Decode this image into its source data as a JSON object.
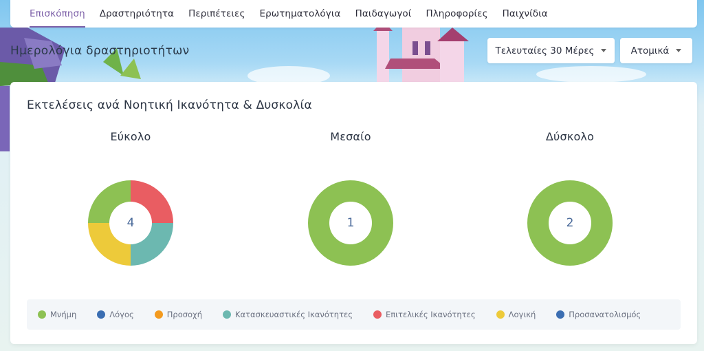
{
  "nav": {
    "items": [
      {
        "label": "Επισκόπηση",
        "active": true
      },
      {
        "label": "Δραστηριότητα"
      },
      {
        "label": "Περιπέτειες"
      },
      {
        "label": "Ερωτηματολόγια"
      },
      {
        "label": "Παιδαγωγοί"
      },
      {
        "label": "Πληροφορίες"
      },
      {
        "label": "Παιχνίδια"
      }
    ]
  },
  "header": {
    "title": "Ημερολόγια δραστηριοτήτων",
    "period_dropdown": "Τελευταίες 30 Μέρες",
    "mode_dropdown": "Ατομικά"
  },
  "card": {
    "title": "Εκτελέσεις ανά Νοητική Ικανότητα & Δυσκολία"
  },
  "colors": {
    "memory": "#8dc153",
    "speech": "#3b6eb2",
    "attention": "#f39a1e",
    "constructive": "#6cb8b0",
    "executive": "#e95d62",
    "logic": "#edca3a",
    "orientation": "#3b6eb2"
  },
  "chart_data": [
    {
      "type": "pie",
      "title": "Εύκολο",
      "center_label": "4",
      "categories": [
        "Επιτελικές Ικανότητες",
        "Κατασκευαστικές Ικανότητες",
        "Λογική",
        "Μνήμη"
      ],
      "values": [
        1,
        1,
        1,
        1
      ],
      "colors": [
        "#e95d62",
        "#6cb8b0",
        "#edca3a",
        "#8dc153"
      ]
    },
    {
      "type": "pie",
      "title": "Μεσαίο",
      "center_label": "1",
      "categories": [
        "Μνήμη"
      ],
      "values": [
        1
      ],
      "colors": [
        "#8dc153"
      ]
    },
    {
      "type": "pie",
      "title": "Δύσκολο",
      "center_label": "2",
      "categories": [
        "Μνήμη"
      ],
      "values": [
        2
      ],
      "colors": [
        "#8dc153"
      ]
    }
  ],
  "legend": [
    {
      "label": "Μνήμη",
      "color": "#8dc153"
    },
    {
      "label": "Λόγος",
      "color": "#3b6eb2"
    },
    {
      "label": "Προσοχή",
      "color": "#f39a1e"
    },
    {
      "label": "Κατασκευαστικές Ικανότητες",
      "color": "#6cb8b0"
    },
    {
      "label": "Επιτελικές Ικανότητες",
      "color": "#e95d62"
    },
    {
      "label": "Λογική",
      "color": "#edca3a"
    },
    {
      "label": "Προσανατολισμός",
      "color": "#3b6eb2"
    }
  ]
}
